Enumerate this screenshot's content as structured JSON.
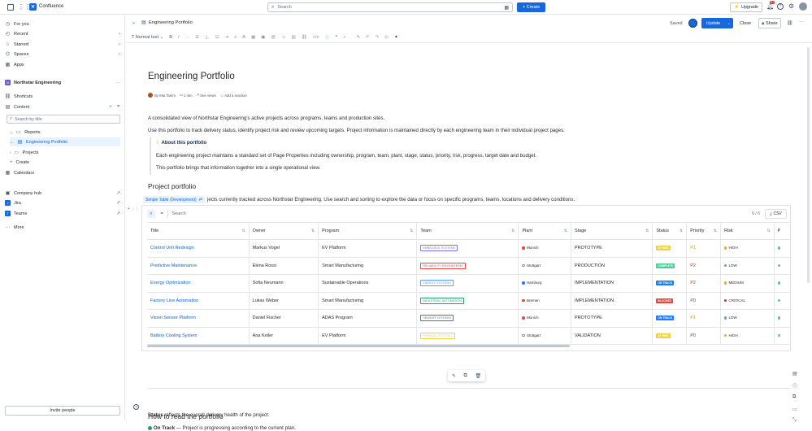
{
  "topbar": {
    "app_name": "Confluence",
    "search_placeholder": "Search",
    "create_label": "+ Create",
    "upgrade_label": "Upgrade",
    "notifications_count": "9+"
  },
  "sidebar": {
    "top_items": [
      {
        "label": "For you",
        "icon": "clock-icon"
      },
      {
        "label": "Recent",
        "icon": "history-icon"
      },
      {
        "label": "Starred",
        "icon": "star-icon"
      },
      {
        "label": "Spaces",
        "icon": "spaces-icon"
      },
      {
        "label": "Apps",
        "icon": "apps-icon"
      }
    ],
    "space_name": "Northstar Engineering",
    "shortcuts_label": "Shortcuts",
    "content_label": "Content",
    "search_placeholder": "Search by title",
    "tree": {
      "reports": "Reports",
      "engineering_portfolio": "Engineering Portfolio",
      "projects": "Projects",
      "create": "Create"
    },
    "calendars": "Calendars",
    "links": [
      {
        "label": "Company hub",
        "icon": "hub-icon"
      },
      {
        "label": "Jira",
        "icon": "jira-icon"
      },
      {
        "label": "Teams",
        "icon": "teams-icon"
      }
    ],
    "more": "More",
    "invite": "Invite people"
  },
  "pagebar": {
    "breadcrumb": "Engineering Portfolio",
    "saved": "Saved",
    "update": "Update",
    "close": "Close",
    "share": "Share"
  },
  "toolbar": {
    "text_style": "Normal text"
  },
  "page": {
    "title": "Engineering Portfolio",
    "byline_author": "By Mia Tamm",
    "byline_read": "1 min",
    "byline_views": "See views",
    "byline_reaction": "Add a reaction",
    "intro": "A consolidated view of Northstar Engineering’s active projects across programs, teams and production sites.",
    "usage": "Use this portfolio to track delivery status, identify project risk and review upcoming targets. Project information is maintained directly by each engineering team in their individual project pages.",
    "panel_title": "About this portfolio",
    "panel_line1": "Each engineering project maintains a standard set of Page Properties including ownership, program, team, plant, stage, status, priority, risk, progress, target date and budget.",
    "panel_line2": "This portfolio brings that information together into a single operational view.",
    "section_heading": "Project portfolio",
    "macro_label": "Simple Table (Development)",
    "section_desc_visible": "jects currently tracked across Northstar Engineering. Use search and sorting to explore the data or focus on specific programs, teams, locations and delivery conditions.",
    "read_heading": "How to read the portfolio",
    "status_bold": "Status",
    "status_text": " reflects the overall delivery health of the project.",
    "ontrack_bold": "On Track",
    "ontrack_text": " — Project is progressing according to the current plan."
  },
  "table": {
    "search_placeholder": "Search",
    "count": "6 / 6",
    "csv": "CSV",
    "columns": [
      "Title",
      "Owner",
      "Program",
      "Team",
      "Plant",
      "Stage",
      "Status",
      "Priority",
      "Risk",
      "P"
    ],
    "rows": [
      {
        "title": "Control Unit Redesign",
        "owner": "Markus Vogel",
        "program": "EV Platform",
        "team": "EMBEDDED SYSTEMS",
        "team_color": "#8270db",
        "plant": "Munich",
        "plant_color": "#e2483d",
        "stage": "PROTOTYPE",
        "status": "AT RISK",
        "status_color": "#f5cd47",
        "priority": "P1",
        "priority_color": "#cf9f02",
        "risk": "HIGH",
        "risk_color": "#fca700"
      },
      {
        "title": "Predictive Maintenance",
        "owner": "Elena Rossi",
        "program": "Smart Manufacturing",
        "team": "RELIABILITY ENGINEERING",
        "team_color": "#e2483d",
        "plant": "Stuttgart",
        "plant_color": "#ffffff",
        "stage": "PRODUCTION",
        "status": "COMPLETE",
        "status_color": "#4bce97",
        "priority": "P2",
        "priority_color": "#c9372c",
        "risk": "LOW",
        "risk_color": "#579dff"
      },
      {
        "title": "Energy Optimization",
        "owner": "Sofia Neumann",
        "program": "Sustainable Operations",
        "team": "ENERGY SYSTEMS",
        "team_color": "#579dff",
        "plant": "Hamburg",
        "plant_color": "#1d7afc",
        "stage": "IMPLEMENTATION",
        "status": "ON TRACK",
        "status_color": "#1d7afc",
        "priority": "P2",
        "priority_color": "#c9372c",
        "risk": "MEDIUM",
        "risk_color": "#fca700"
      },
      {
        "title": "Factory Line Automation",
        "owner": "Lukas Weber",
        "program": "Smart Manufacturing",
        "team": "INDUSTRIAL AUTOMATION",
        "team_color": "#22a06b",
        "plant": "Bremen",
        "plant_color": "#e2483d",
        "stage": "IMPLEMENTATION",
        "status": "BLOCKED",
        "status_color": "#e2483d",
        "priority": "P0",
        "priority_color": "#44546f",
        "risk": "CRITICAL",
        "risk_color": "#c9372c"
      },
      {
        "title": "Vision Sensor Platform",
        "owner": "Daniel Fischer",
        "program": "ADAS Program",
        "team": "SENSOR SYSTEMS",
        "team_color": "#626f86",
        "plant": "Munich",
        "plant_color": "#e2483d",
        "stage": "PROTOTYPE",
        "status": "ON TRACK",
        "status_color": "#1d7afc",
        "priority": "P1",
        "priority_color": "#cf9f02",
        "risk": "LOW",
        "risk_color": "#579dff"
      },
      {
        "title": "Battery Cooling System",
        "owner": "Ana Keller",
        "program": "EV Platform",
        "team": "THERMAL SYSTEMS",
        "team_color": "#f5cd47",
        "plant": "Stuttgart",
        "plant_color": "#ffffff",
        "stage": "VALIDATION",
        "status": "AT RISK",
        "status_color": "#f5cd47",
        "priority": "P0",
        "priority_color": "#44546f",
        "risk": "HIGH",
        "risk_color": "#fca700"
      }
    ]
  },
  "colors": {
    "brand": "#1868db",
    "link": "#0c66e4",
    "selected_bg": "#e9f2ff"
  }
}
